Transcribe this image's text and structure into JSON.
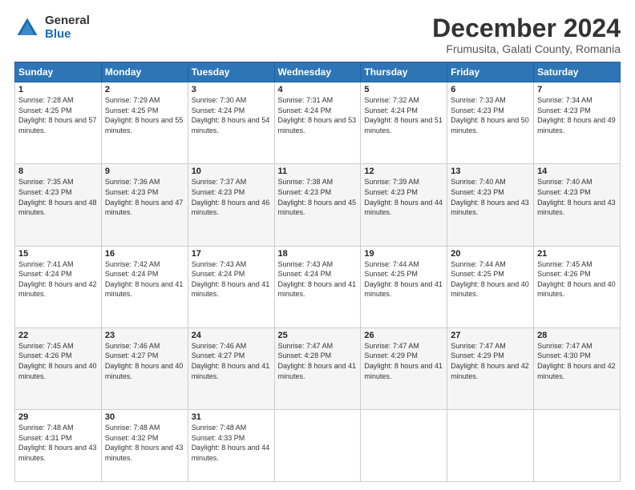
{
  "header": {
    "logo_general": "General",
    "logo_blue": "Blue",
    "main_title": "December 2024",
    "subtitle": "Frumusita, Galati County, Romania"
  },
  "calendar": {
    "headers": [
      "Sunday",
      "Monday",
      "Tuesday",
      "Wednesday",
      "Thursday",
      "Friday",
      "Saturday"
    ],
    "weeks": [
      [
        {
          "day": "1",
          "sunrise": "Sunrise: 7:28 AM",
          "sunset": "Sunset: 4:25 PM",
          "daylight": "Daylight: 8 hours and 57 minutes."
        },
        {
          "day": "2",
          "sunrise": "Sunrise: 7:29 AM",
          "sunset": "Sunset: 4:25 PM",
          "daylight": "Daylight: 8 hours and 55 minutes."
        },
        {
          "day": "3",
          "sunrise": "Sunrise: 7:30 AM",
          "sunset": "Sunset: 4:24 PM",
          "daylight": "Daylight: 8 hours and 54 minutes."
        },
        {
          "day": "4",
          "sunrise": "Sunrise: 7:31 AM",
          "sunset": "Sunset: 4:24 PM",
          "daylight": "Daylight: 8 hours and 53 minutes."
        },
        {
          "day": "5",
          "sunrise": "Sunrise: 7:32 AM",
          "sunset": "Sunset: 4:24 PM",
          "daylight": "Daylight: 8 hours and 51 minutes."
        },
        {
          "day": "6",
          "sunrise": "Sunrise: 7:33 AM",
          "sunset": "Sunset: 4:23 PM",
          "daylight": "Daylight: 8 hours and 50 minutes."
        },
        {
          "day": "7",
          "sunrise": "Sunrise: 7:34 AM",
          "sunset": "Sunset: 4:23 PM",
          "daylight": "Daylight: 8 hours and 49 minutes."
        }
      ],
      [
        {
          "day": "8",
          "sunrise": "Sunrise: 7:35 AM",
          "sunset": "Sunset: 4:23 PM",
          "daylight": "Daylight: 8 hours and 48 minutes."
        },
        {
          "day": "9",
          "sunrise": "Sunrise: 7:36 AM",
          "sunset": "Sunset: 4:23 PM",
          "daylight": "Daylight: 8 hours and 47 minutes."
        },
        {
          "day": "10",
          "sunrise": "Sunrise: 7:37 AM",
          "sunset": "Sunset: 4:23 PM",
          "daylight": "Daylight: 8 hours and 46 minutes."
        },
        {
          "day": "11",
          "sunrise": "Sunrise: 7:38 AM",
          "sunset": "Sunset: 4:23 PM",
          "daylight": "Daylight: 8 hours and 45 minutes."
        },
        {
          "day": "12",
          "sunrise": "Sunrise: 7:39 AM",
          "sunset": "Sunset: 4:23 PM",
          "daylight": "Daylight: 8 hours and 44 minutes."
        },
        {
          "day": "13",
          "sunrise": "Sunrise: 7:40 AM",
          "sunset": "Sunset: 4:23 PM",
          "daylight": "Daylight: 8 hours and 43 minutes."
        },
        {
          "day": "14",
          "sunrise": "Sunrise: 7:40 AM",
          "sunset": "Sunset: 4:23 PM",
          "daylight": "Daylight: 8 hours and 43 minutes."
        }
      ],
      [
        {
          "day": "15",
          "sunrise": "Sunrise: 7:41 AM",
          "sunset": "Sunset: 4:24 PM",
          "daylight": "Daylight: 8 hours and 42 minutes."
        },
        {
          "day": "16",
          "sunrise": "Sunrise: 7:42 AM",
          "sunset": "Sunset: 4:24 PM",
          "daylight": "Daylight: 8 hours and 41 minutes."
        },
        {
          "day": "17",
          "sunrise": "Sunrise: 7:43 AM",
          "sunset": "Sunset: 4:24 PM",
          "daylight": "Daylight: 8 hours and 41 minutes."
        },
        {
          "day": "18",
          "sunrise": "Sunrise: 7:43 AM",
          "sunset": "Sunset: 4:24 PM",
          "daylight": "Daylight: 8 hours and 41 minutes."
        },
        {
          "day": "19",
          "sunrise": "Sunrise: 7:44 AM",
          "sunset": "Sunset: 4:25 PM",
          "daylight": "Daylight: 8 hours and 41 minutes."
        },
        {
          "day": "20",
          "sunrise": "Sunrise: 7:44 AM",
          "sunset": "Sunset: 4:25 PM",
          "daylight": "Daylight: 8 hours and 40 minutes."
        },
        {
          "day": "21",
          "sunrise": "Sunrise: 7:45 AM",
          "sunset": "Sunset: 4:26 PM",
          "daylight": "Daylight: 8 hours and 40 minutes."
        }
      ],
      [
        {
          "day": "22",
          "sunrise": "Sunrise: 7:45 AM",
          "sunset": "Sunset: 4:26 PM",
          "daylight": "Daylight: 8 hours and 40 minutes."
        },
        {
          "day": "23",
          "sunrise": "Sunrise: 7:46 AM",
          "sunset": "Sunset: 4:27 PM",
          "daylight": "Daylight: 8 hours and 40 minutes."
        },
        {
          "day": "24",
          "sunrise": "Sunrise: 7:46 AM",
          "sunset": "Sunset: 4:27 PM",
          "daylight": "Daylight: 8 hours and 41 minutes."
        },
        {
          "day": "25",
          "sunrise": "Sunrise: 7:47 AM",
          "sunset": "Sunset: 4:28 PM",
          "daylight": "Daylight: 8 hours and 41 minutes."
        },
        {
          "day": "26",
          "sunrise": "Sunrise: 7:47 AM",
          "sunset": "Sunset: 4:29 PM",
          "daylight": "Daylight: 8 hours and 41 minutes."
        },
        {
          "day": "27",
          "sunrise": "Sunrise: 7:47 AM",
          "sunset": "Sunset: 4:29 PM",
          "daylight": "Daylight: 8 hours and 42 minutes."
        },
        {
          "day": "28",
          "sunrise": "Sunrise: 7:47 AM",
          "sunset": "Sunset: 4:30 PM",
          "daylight": "Daylight: 8 hours and 42 minutes."
        }
      ],
      [
        {
          "day": "29",
          "sunrise": "Sunrise: 7:48 AM",
          "sunset": "Sunset: 4:31 PM",
          "daylight": "Daylight: 8 hours and 43 minutes."
        },
        {
          "day": "30",
          "sunrise": "Sunrise: 7:48 AM",
          "sunset": "Sunset: 4:32 PM",
          "daylight": "Daylight: 8 hours and 43 minutes."
        },
        {
          "day": "31",
          "sunrise": "Sunrise: 7:48 AM",
          "sunset": "Sunset: 4:33 PM",
          "daylight": "Daylight: 8 hours and 44 minutes."
        },
        null,
        null,
        null,
        null
      ]
    ]
  }
}
